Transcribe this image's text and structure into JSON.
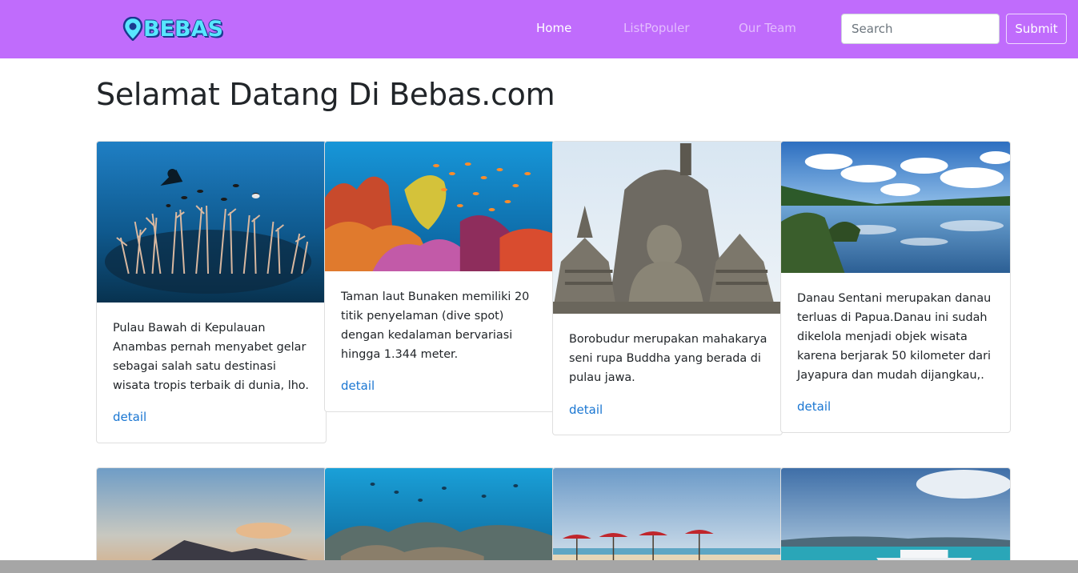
{
  "navbar": {
    "brand": "BEBAS",
    "links": [
      {
        "label": "Home",
        "active": true
      },
      {
        "label": "ListPopuler",
        "active": false
      },
      {
        "label": "Our Team",
        "active": false
      }
    ],
    "search": {
      "placeholder": "Search",
      "value": ""
    },
    "submit_label": "Submit",
    "color": "#c06cfc"
  },
  "page": {
    "title": "Selamat Datang Di Bebas.com"
  },
  "cards": [
    {
      "image": "coral-reef-diver-photo",
      "text": "Pulau Bawah di Kepulauan Anambas pernah menyabet gelar sebagai salah satu destinasi wisata tropis terbaik di dunia, lho.",
      "link": "detail"
    },
    {
      "image": "colorful-reef-fish-photo",
      "text": "Taman laut Bunaken memiliki 20 titik penyelaman (dive spot) dengan kedalaman bervariasi hingga 1.344 meter.",
      "link": "detail"
    },
    {
      "image": "borobudur-buddha-stupa-photo",
      "text": "Borobudur merupakan mahakarya seni rupa Buddha yang berada di pulau jawa.",
      "link": "detail"
    },
    {
      "image": "lake-sentani-photo",
      "text": "Danau Sentani merupakan danau terluas di Papua.Danau ini sudah dikelola menjadi objek wisata karena berjarak 50 kilometer dari Jayapura dan mudah dijangkau,.",
      "link": "detail"
    }
  ],
  "cards_row2": [
    {
      "image": "volcano-sunrise-photo"
    },
    {
      "image": "underwater-reef-photo"
    },
    {
      "image": "beach-umbrellas-photo"
    },
    {
      "image": "harbor-boat-photo"
    }
  ],
  "colors": {
    "link": "#1976d2",
    "heading": "#212529"
  }
}
